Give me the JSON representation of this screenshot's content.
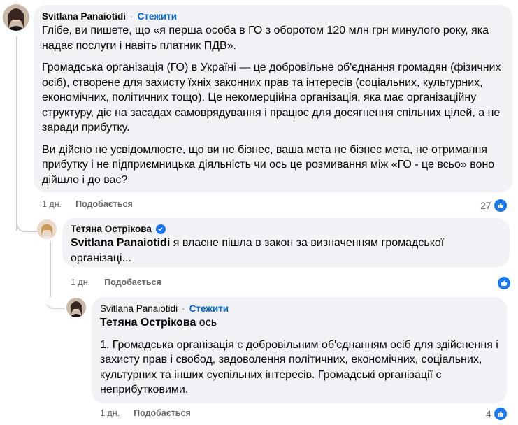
{
  "comments": [
    {
      "author": "Svitlana Panaiotidi",
      "follow": "Стежити",
      "separator": "·",
      "paragraphs": [
        "Глібе, ви пишете, що «я перша особа в ГО з оборотом 120 млн грн минулого року, яка надає послуги і навіть платник ПДВ».",
        "Громадська організація (ГО) в Україні — це добровільне об'єднання громадян (фізичних осіб), створене для захисту їхніх законних прав та інтересів (соціальних, культурних, економічних, політичних тощо). Це некомерційна організація, яка має організаційну структуру, діє на засадах самоврядування і працює для досягнення спільних цілей, а не заради прибутку.",
        "Ви дійсно не усвідомлюєте, що ви не бізнес, ваша мета не бізнес мета, не отримання прибутку і не підприємницька діяльність чи ось це розмивання між «ГО - це всьо» воно дійшло і до вас?"
      ],
      "time": "1 дн.",
      "like": "Подобається",
      "reaction_count": "27"
    },
    {
      "author": "Тетяна Острікова",
      "mention": "Svitlana Panaiotidi",
      "text": " я власне пішла в закон за визначенням громадської організаці...",
      "time": "1 дн.",
      "like": "Подобається",
      "reaction_count": ""
    },
    {
      "author": "Svitlana Panaiotidi",
      "follow": "Стежити",
      "separator": "·",
      "mention": "Тетяна Острікова",
      "mention_text": " ось",
      "paragraph": "1. Громадська організація є добровільним об'єднанням осіб для здійснення і захисту прав і свобод, задоволення політичних, економічних, соціальних, культурних та інших суспільних інтересів. Громадські організації є неприбутковими.",
      "time": "1 дн.",
      "like": "Подобається",
      "reaction_count": "4"
    }
  ],
  "colors": {
    "bubble": "#f0f2f5",
    "link": "#0064d1",
    "meta": "#65676b",
    "like_blue": "#1877f2"
  },
  "icons": {
    "reaction": "thumbs-up-icon",
    "verified": "verified-badge-icon"
  }
}
